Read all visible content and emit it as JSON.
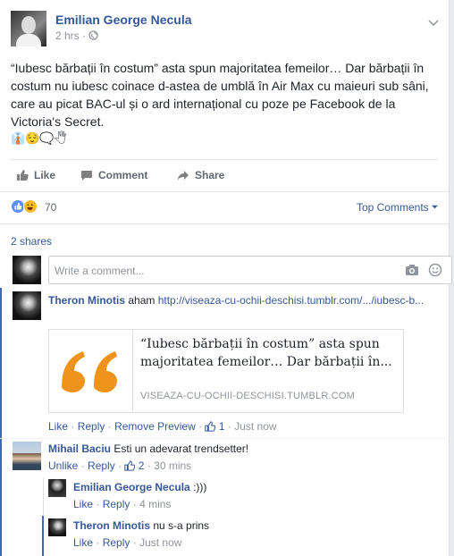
{
  "post": {
    "author": "Emilian George Necula",
    "time": "2 hrs",
    "dot": "·",
    "text": "“Iubesc bărbații în costum” asta spun majoritatea femeilor… Dar bărbații în costum nu iubesc coinace d-astea de umblă în Air Max cu maieuri sub sâni, care au picat BAC-ul și o ard internațional cu poze pe Facebook de la Victoria's Secret.",
    "emoji_line": "👔😌🗨️🖑"
  },
  "actions": {
    "like": "Like",
    "comment": "Comment",
    "share": "Share"
  },
  "reactions": {
    "count": "70",
    "sort_label": "Top Comments"
  },
  "shares": "2 shares",
  "composer": {
    "placeholder": "Write a comment..."
  },
  "comments": [
    {
      "author": "Theron Minotis",
      "text": "aham",
      "link": "http://viseaza-cu-ochii-deschisi.tumblr.com/.../iubesc-b...",
      "preview": {
        "title": "“Iubesc bărbații în costum” asta spun majoritatea femeilor… Dar bărbații în...",
        "domain": "VISEAZA-CU-OCHII-DESCHISI.TUMBLR.COM",
        "quote_color": "#f0931c"
      },
      "actions": {
        "like": "Like",
        "reply": "Reply",
        "remove": "Remove Preview",
        "likes": "1",
        "time": "Just now"
      }
    },
    {
      "author": "Mihail Baciu",
      "text": "Esti un adevarat trendsetter!",
      "actions": {
        "unlike": "Unlike",
        "reply": "Reply",
        "likes": "2",
        "time": "30 mins"
      }
    }
  ],
  "replies": [
    {
      "author": "Emilian George Necula",
      "text": ":)))",
      "actions": {
        "like": "Like",
        "reply": "Reply",
        "time": "4 mins"
      }
    },
    {
      "author": "Theron Minotis",
      "text": "nu s-a prins",
      "actions": {
        "like": "Like",
        "reply": "Reply",
        "time": "Just now"
      }
    }
  ],
  "colors": {
    "brand": "#365899",
    "accent": "#4267b2",
    "muted": "#90949c"
  }
}
